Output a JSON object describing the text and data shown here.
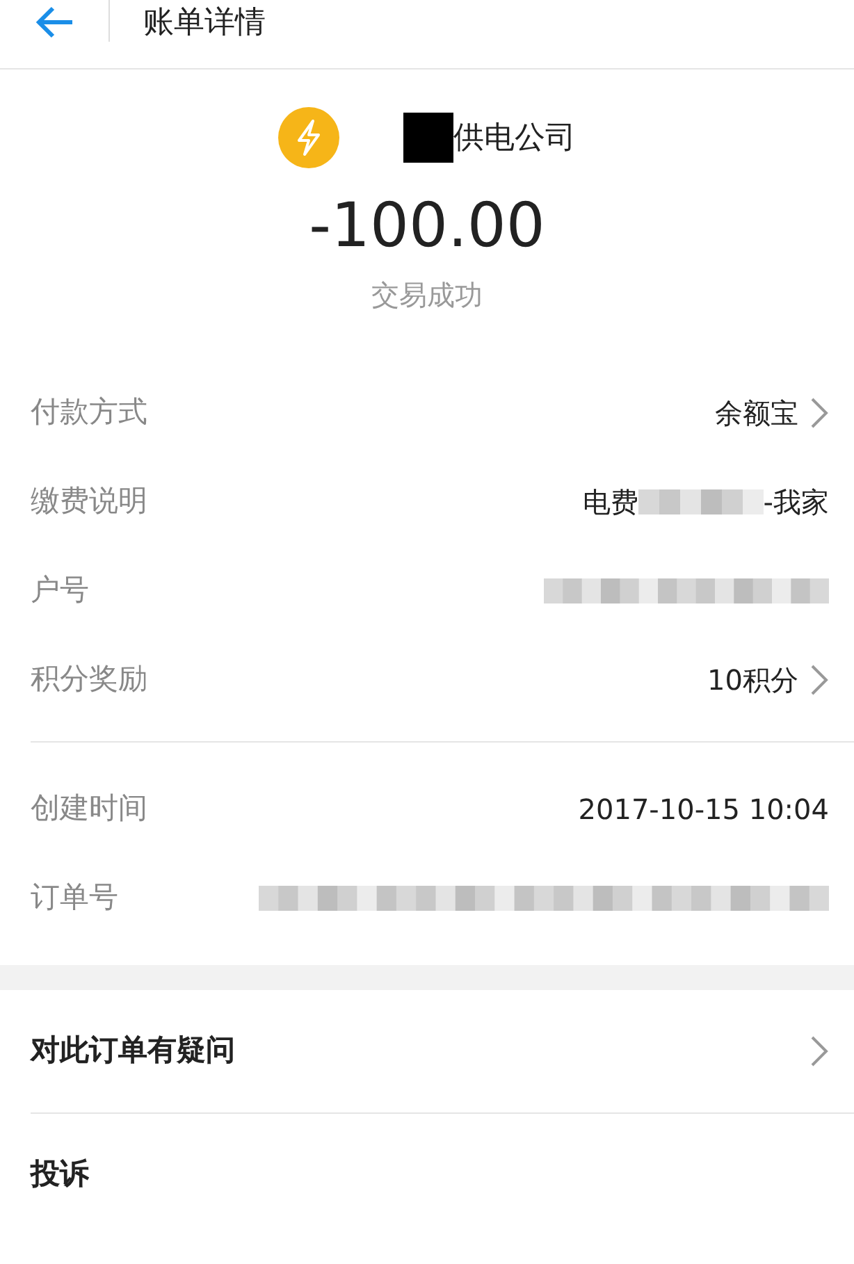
{
  "header": {
    "title": "账单详情"
  },
  "merchant": {
    "name": "供电公司",
    "redacted": true
  },
  "amount": "-100.00",
  "status": "交易成功",
  "detail_groups": [
    [
      {
        "label": "付款方式",
        "parts": [
          {
            "kind": "text",
            "text": "余额宝"
          }
        ],
        "chevron": true
      },
      {
        "label": "缴费说明",
        "parts": [
          {
            "kind": "text",
            "text": "电费"
          },
          {
            "kind": "blur_short"
          },
          {
            "kind": "text",
            "text": "-我家"
          }
        ],
        "chevron": false
      },
      {
        "label": "户号",
        "parts": [
          {
            "kind": "blur_medium"
          }
        ],
        "chevron": false
      },
      {
        "label": "积分奖励",
        "parts": [
          {
            "kind": "text",
            "text": "10积分"
          }
        ],
        "chevron": true
      }
    ],
    [
      {
        "label": "创建时间",
        "parts": [
          {
            "kind": "text",
            "text": "2017-10-15 10:04"
          }
        ],
        "chevron": false
      },
      {
        "label": "订单号",
        "parts": [
          {
            "kind": "blur_long"
          }
        ],
        "chevron": false
      }
    ]
  ],
  "actions": [
    {
      "label": "对此订单有疑问",
      "chevron": true
    },
    {
      "label": "投诉",
      "chevron": false
    }
  ]
}
